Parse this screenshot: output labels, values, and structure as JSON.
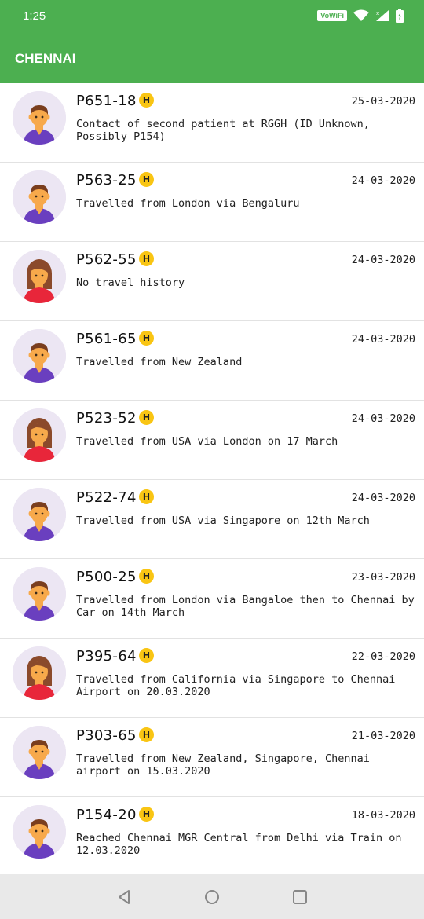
{
  "status_bar": {
    "time": "1:25",
    "wifi_label": "VoWiFi"
  },
  "app_bar": {
    "title": "CHENNAI"
  },
  "patients": [
    {
      "id": "P651-18",
      "badge": "H",
      "date": "25-03-2020",
      "description": "Contact of second patient at RGGH (ID Unknown, Possibly P154)",
      "gender": "male"
    },
    {
      "id": "P563-25",
      "badge": "H",
      "date": "24-03-2020",
      "description": "Travelled from London via Bengaluru",
      "gender": "male"
    },
    {
      "id": "P562-55",
      "badge": "H",
      "date": "24-03-2020",
      "description": "No travel history",
      "gender": "female"
    },
    {
      "id": "P561-65",
      "badge": "H",
      "date": "24-03-2020",
      "description": "Travelled from New Zealand",
      "gender": "male"
    },
    {
      "id": "P523-52",
      "badge": "H",
      "date": "24-03-2020",
      "description": "Travelled from USA via London on 17 March",
      "gender": "female"
    },
    {
      "id": "P522-74",
      "badge": "H",
      "date": "24-03-2020",
      "description": "Travelled from USA via Singapore on 12th March",
      "gender": "male"
    },
    {
      "id": "P500-25",
      "badge": "H",
      "date": "23-03-2020",
      "description": "Travelled from London via Bangaloe then to Chennai by Car on 14th March",
      "gender": "male"
    },
    {
      "id": "P395-64",
      "badge": "H",
      "date": "22-03-2020",
      "description": "Travelled from California via Singapore to Chennai Airport on 20.03.2020",
      "gender": "female"
    },
    {
      "id": "P303-65",
      "badge": "H",
      "date": "21-03-2020",
      "description": "Travelled from New Zealand, Singapore, Chennai airport on 15.03.2020",
      "gender": "male"
    },
    {
      "id": "P154-20",
      "badge": "H",
      "date": "18-03-2020",
      "description": "Reached Chennai MGR Central from Delhi via Train on 12.03.2020",
      "gender": "male"
    }
  ],
  "colors": {
    "primary": "#4CAF50",
    "badge": "#F9C513",
    "male_shirt": "#6A3FBF",
    "female_shirt": "#E8263A",
    "avatar_bg": "#ECE6F3"
  }
}
